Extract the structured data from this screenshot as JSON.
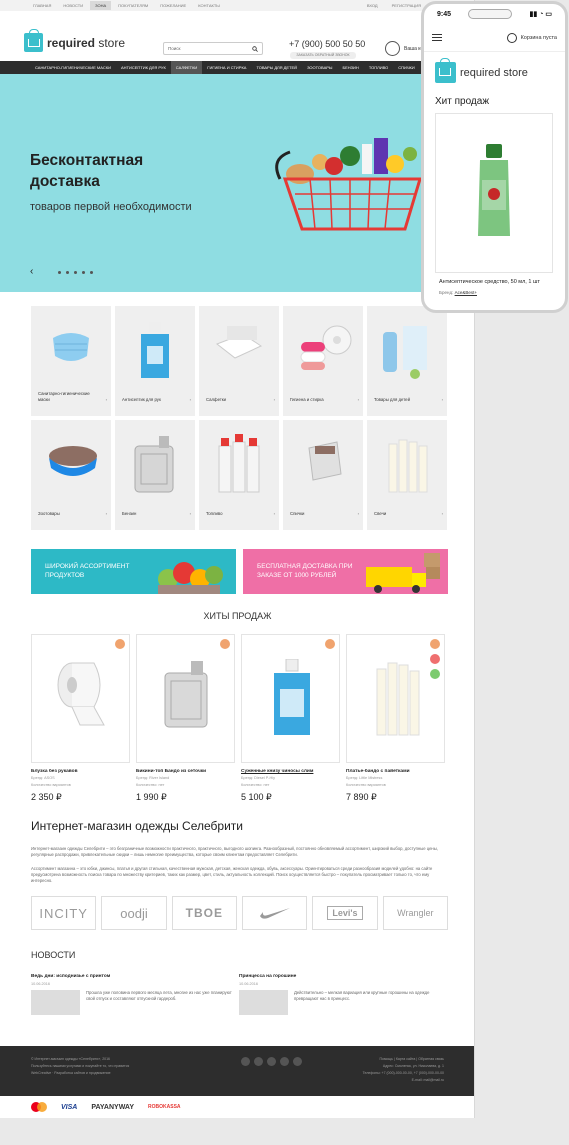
{
  "topnav": {
    "items": [
      "Главная",
      "Новости",
      "Зона",
      "Покупателям",
      "Пожелание",
      "Контакты"
    ],
    "right": [
      "Вход",
      "Регистрация"
    ]
  },
  "header": {
    "brand_bold": "required",
    "brand_rest": " store",
    "search_placeholder": "Поиск",
    "phone": "+7 (900) 500 50 50",
    "callback": "Заказать обратный звонок",
    "cart": "Ваша корзина"
  },
  "catnav": [
    "Санитарно-гигиенические маски",
    "Антисептик для рук",
    "Салфетки",
    "Гигиена и стирка",
    "Товары для детей",
    "Зоотовары",
    "Бензин",
    "Топливо",
    "Спички"
  ],
  "hero": {
    "title": "Бесконтактная доставка",
    "subtitle": "товаров первой необходимости",
    "arrow": "‹"
  },
  "categories": [
    {
      "name": "Санитарно-гигиенические маски",
      "icon": "mask-icon"
    },
    {
      "name": "Антисептик для рук",
      "icon": "bottle-icon"
    },
    {
      "name": "Салфетки",
      "icon": "napkins-icon"
    },
    {
      "name": "Гигиена и стирка",
      "icon": "soap-icon"
    },
    {
      "name": "Товары для детей",
      "icon": "baby-bottle-icon"
    },
    {
      "name": "Зоотовары",
      "icon": "pet-bowl-icon"
    },
    {
      "name": "Бензин",
      "icon": "canister-icon"
    },
    {
      "name": "Топливо",
      "icon": "gas-cylinder-icon"
    },
    {
      "name": "Спички",
      "icon": "matches-icon"
    },
    {
      "name": "Свечи",
      "icon": "candles-icon"
    }
  ],
  "banners": [
    {
      "text": "Широкий ассортимент продуктов",
      "color": "#2db9c6"
    },
    {
      "text": "Бесплатная доставка при заказе от 1000 рублей",
      "color": "#ef6fa6"
    }
  ],
  "hits_title": "Хиты продаж",
  "products": [
    {
      "name": "Блузка без рукавов",
      "brand": "Бренд: ASOS",
      "qty": "Количество вариантов",
      "price": "2 350 ₽"
    },
    {
      "name": "Бикини-топ Бандо из сеточки",
      "brand": "Бренд: River Island",
      "qty": "Количество: нет",
      "price": "1 990 ₽"
    },
    {
      "name": "Суженные книзу чиносы слим",
      "brand": "Бренд: Diesel P-Hiy",
      "qty": "Количество: нет",
      "price": "5 100 ₽"
    },
    {
      "name": "Платье-бандо с пайетками",
      "brand": "Бренд: Little Mistress",
      "qty": "Количество вариантов",
      "price": "7 890 ₽"
    }
  ],
  "about": {
    "title": "Интернет-магазин одежды Селебрити",
    "p1": "Интернет-магазин одежды Селебрити – это безграничные возможности практичного, практичного, выгодного шопинга. Разнообразный, постоянно обновляемый ассортимент, широкий выбор, доступные цены, регулярные распродажи, привлекательные скидки – лишь немногие преимущества, которые своим клиентам предоставляет Селебрити.",
    "p2": "Ассортимент магазина – это юбки, джинсы, платья и другая стильная, качественная мужская, детская, женская одежда, обувь, аксессуары. Ориентироваться среди разнообразия моделей удобно: на сайте предусмотрена возможность поиска товара по множеству критериев, таких как размер, цвет, стиль, актуальность коллекций. Поиск осуществляется быстро – покупатель просматривает только то, что ему интересно."
  },
  "brands": [
    "INCITY",
    "oodji",
    "TBOE",
    "Nike",
    "Levi's",
    "Wrangler"
  ],
  "news_title": "Новости",
  "news": [
    {
      "title": "Ведь дни: исподнизье с принтом",
      "date": "10.06.2016",
      "text": "Прошла уже половина первого месяца лета, многие из нас уже планируют свой отпуск и составляют отпускной гардероб."
    },
    {
      "title": "Принцесса на горошине",
      "date": "10.06.2016",
      "text": "Действительно – мелкая вариация или крупные горошины на одежде превращают нас в принцесс."
    }
  ],
  "footer": {
    "left": [
      "© Интернет-магазин одежды «Селебрити», 2016",
      "Пользуйтесь нашими услугами и покупайте то, что нравится",
      "WebCreative · Разработка сайтов и продвижение"
    ],
    "right": [
      "Помощь | Карта сайта | Обратная связь",
      "Адрес: Смоленск, ул. Николаева, д. 1",
      "Телефоны: +7 (000)-000-00-00, +7 (000)-000-00-00",
      "E-mail: mail@mail.ru"
    ]
  },
  "payments": [
    "VISA",
    "PAYANYWAY",
    "ROBOKASSA"
  ],
  "mobile": {
    "time": "9:45",
    "cart": "Корзина пуста",
    "brand_bold": "required",
    "brand_rest": " store",
    "title": "Хит продаж",
    "product": "Антисептическое средство, 50 мл, 1 шт",
    "brand_label": "Бренд:",
    "brand_value": "Ace&Best+"
  }
}
